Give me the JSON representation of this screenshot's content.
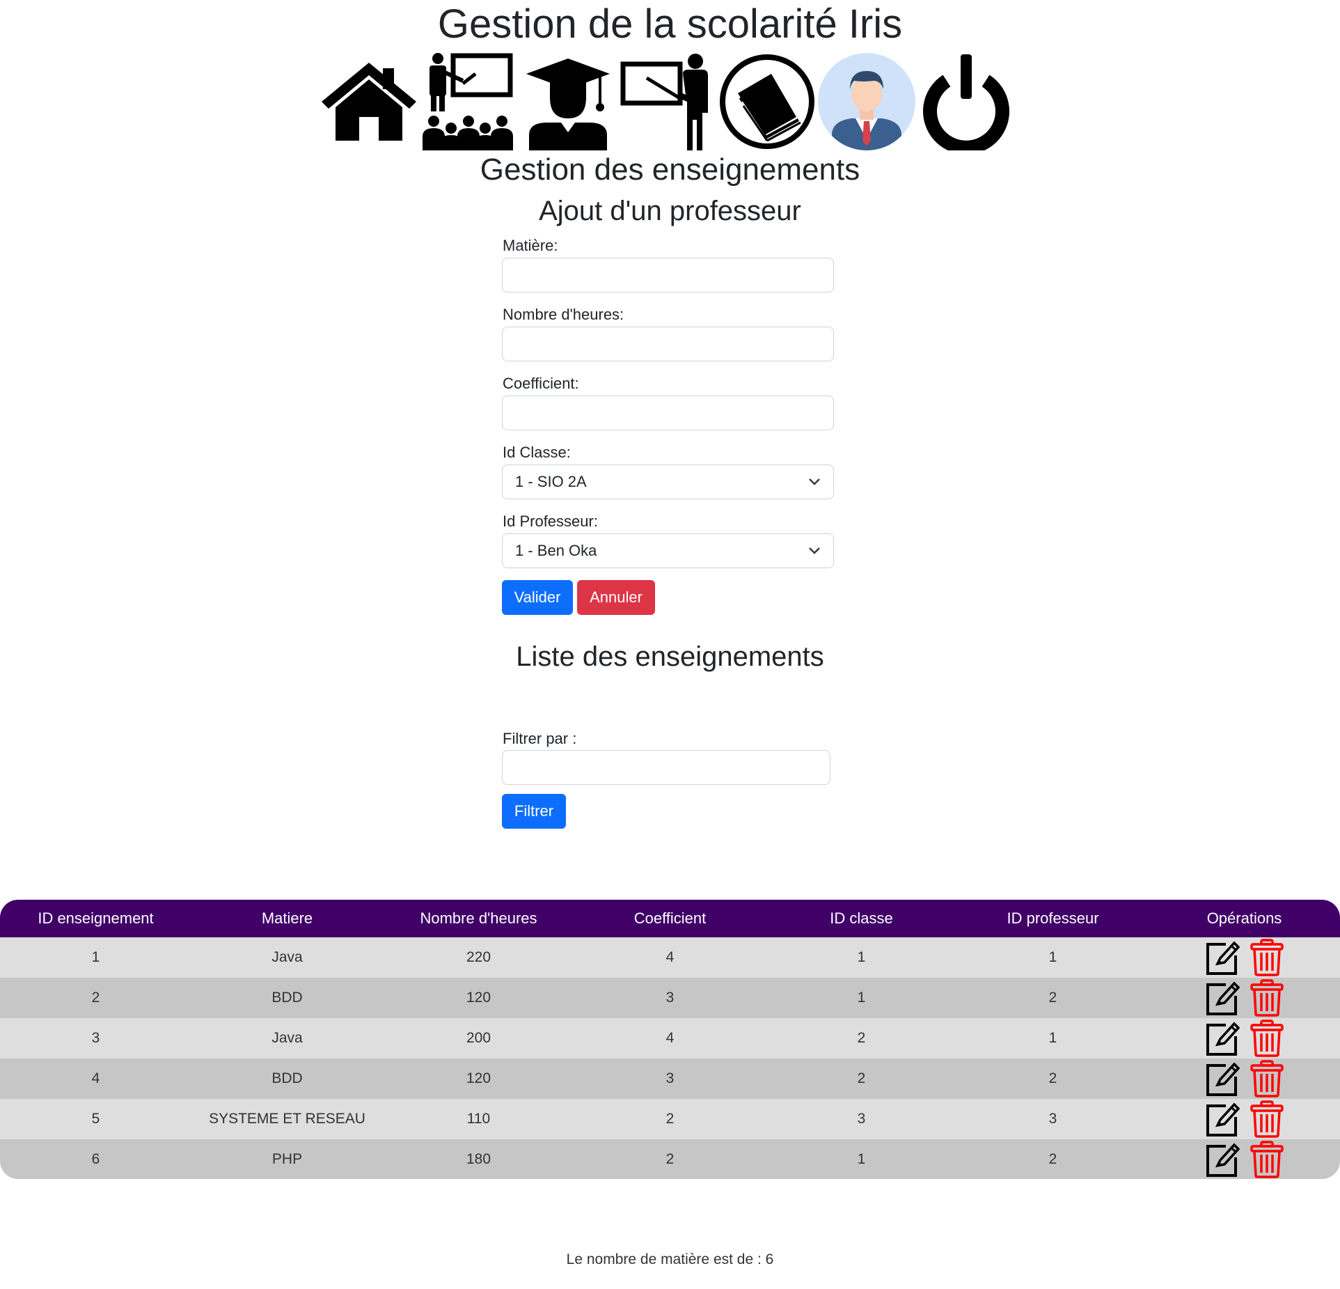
{
  "app": {
    "title": "Gestion de la scolarité Iris"
  },
  "nav": {
    "items": [
      {
        "name": "home-icon"
      },
      {
        "name": "classes-icon"
      },
      {
        "name": "students-icon"
      },
      {
        "name": "teachers-icon"
      },
      {
        "name": "subjects-icon"
      },
      {
        "name": "profile-icon"
      },
      {
        "name": "logout-icon"
      }
    ]
  },
  "page": {
    "title": "Gestion des enseignements",
    "form_title": "Ajout d'un professeur",
    "list_title": "Liste des enseignements"
  },
  "form": {
    "matiere_label": "Matière:",
    "matiere_value": "",
    "heures_label": "Nombre d'heures:",
    "heures_value": "",
    "coefficient_label": "Coefficient:",
    "coefficient_value": "",
    "classe_label": "Id Classe:",
    "classe_selected": "1 - SIO 2A",
    "professeur_label": "Id Professeur:",
    "professeur_selected": "1 - Ben Oka",
    "submit_label": "Valider",
    "cancel_label": "Annuler"
  },
  "filter": {
    "label": "Filtrer par :",
    "value": "",
    "button_label": "Filtrer"
  },
  "table": {
    "headers": [
      "ID enseignement",
      "Matiere",
      "Nombre d'heures",
      "Coefficient",
      "ID classe",
      "ID professeur",
      "Opérations"
    ],
    "rows": [
      [
        "1",
        "Java",
        "220",
        "4",
        "1",
        "1"
      ],
      [
        "2",
        "BDD",
        "120",
        "3",
        "1",
        "2"
      ],
      [
        "3",
        "Java",
        "200",
        "4",
        "2",
        "1"
      ],
      [
        "4",
        "BDD",
        "120",
        "3",
        "2",
        "2"
      ],
      [
        "5",
        "SYSTEME ET RESEAU",
        "110",
        "2",
        "3",
        "3"
      ],
      [
        "6",
        "PHP",
        "180",
        "2",
        "1",
        "2"
      ]
    ]
  },
  "footer": {
    "count_text": "Le nombre de matière est de : 6"
  },
  "colors": {
    "primary": "#0d6efd",
    "danger": "#dc3545",
    "table_header": "#400068",
    "row_light": "#dedede",
    "row_dark": "#c6c6c6",
    "delete_icon": "#ff0000"
  }
}
